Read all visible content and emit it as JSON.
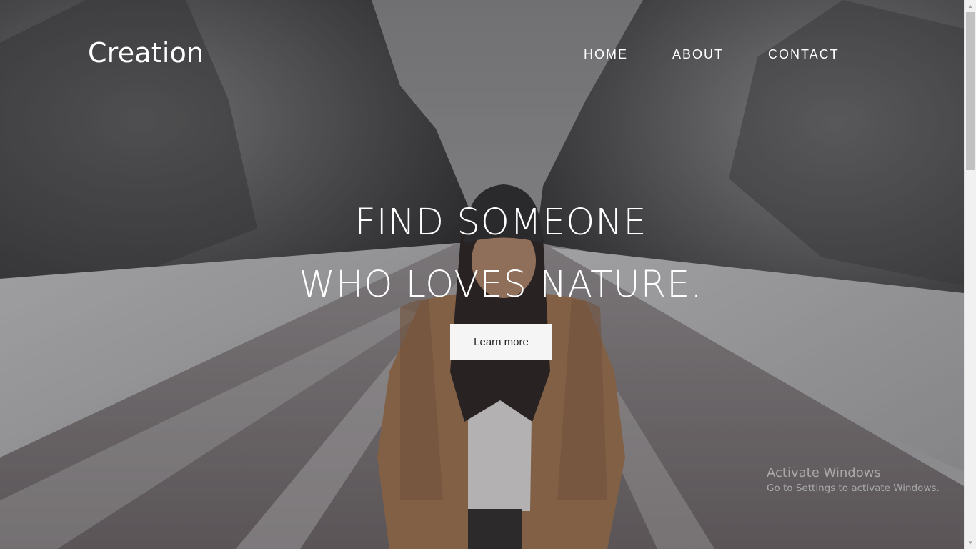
{
  "navbar": {
    "brand": "Creation",
    "links": [
      {
        "label": "HOME"
      },
      {
        "label": "ABOUT"
      },
      {
        "label": "CONTACT"
      }
    ]
  },
  "hero": {
    "title_line1": "FIND SOMEONE",
    "title_line2": "WHO LOVES NATURE.",
    "button_label": "Learn more"
  },
  "watermark": {
    "title": "Activate Windows",
    "subtitle": "Go to Settings to activate Windows."
  },
  "colors": {
    "text": "#ffffff",
    "button_bg": "#f5f5f5",
    "button_text": "#222222",
    "coat": "#a47651"
  }
}
